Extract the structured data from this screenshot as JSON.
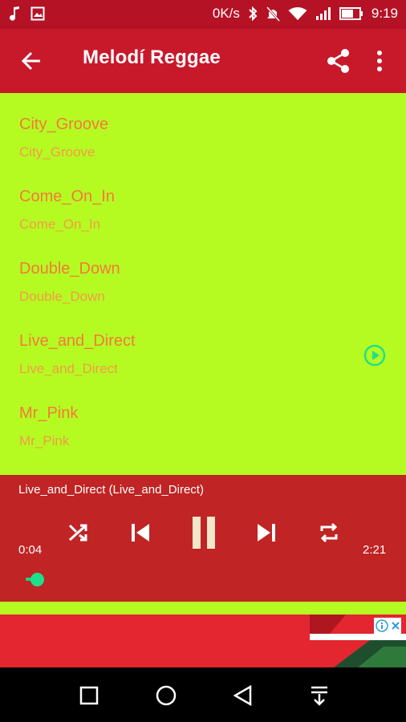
{
  "status_bar": {
    "speed": "0K/s",
    "time": "9:19"
  },
  "app_bar": {
    "title": "Melodí Reggae"
  },
  "tracks": [
    {
      "title": "City_Groove",
      "subtitle": "City_Groove"
    },
    {
      "title": "Come_On_In",
      "subtitle": "Come_On_In"
    },
    {
      "title": "Double_Down",
      "subtitle": "Double_Down"
    },
    {
      "title": "Live_and_Direct",
      "subtitle": "Live_and_Direct",
      "playing": true
    },
    {
      "title": "Mr_Pink",
      "subtitle": "Mr_Pink"
    }
  ],
  "player": {
    "now_playing": "Live_and_Direct (Live_and_Direct)",
    "elapsed": "0:04",
    "duration": "2:21",
    "progress_fraction": 0.03
  },
  "colors": {
    "status_bar": "#b51226",
    "app_bar": "#c8192b",
    "list_bg": "#b5fb22",
    "track_title": "#f47a3a",
    "player_bg": "#c02424",
    "accent": "#1fe08a"
  }
}
